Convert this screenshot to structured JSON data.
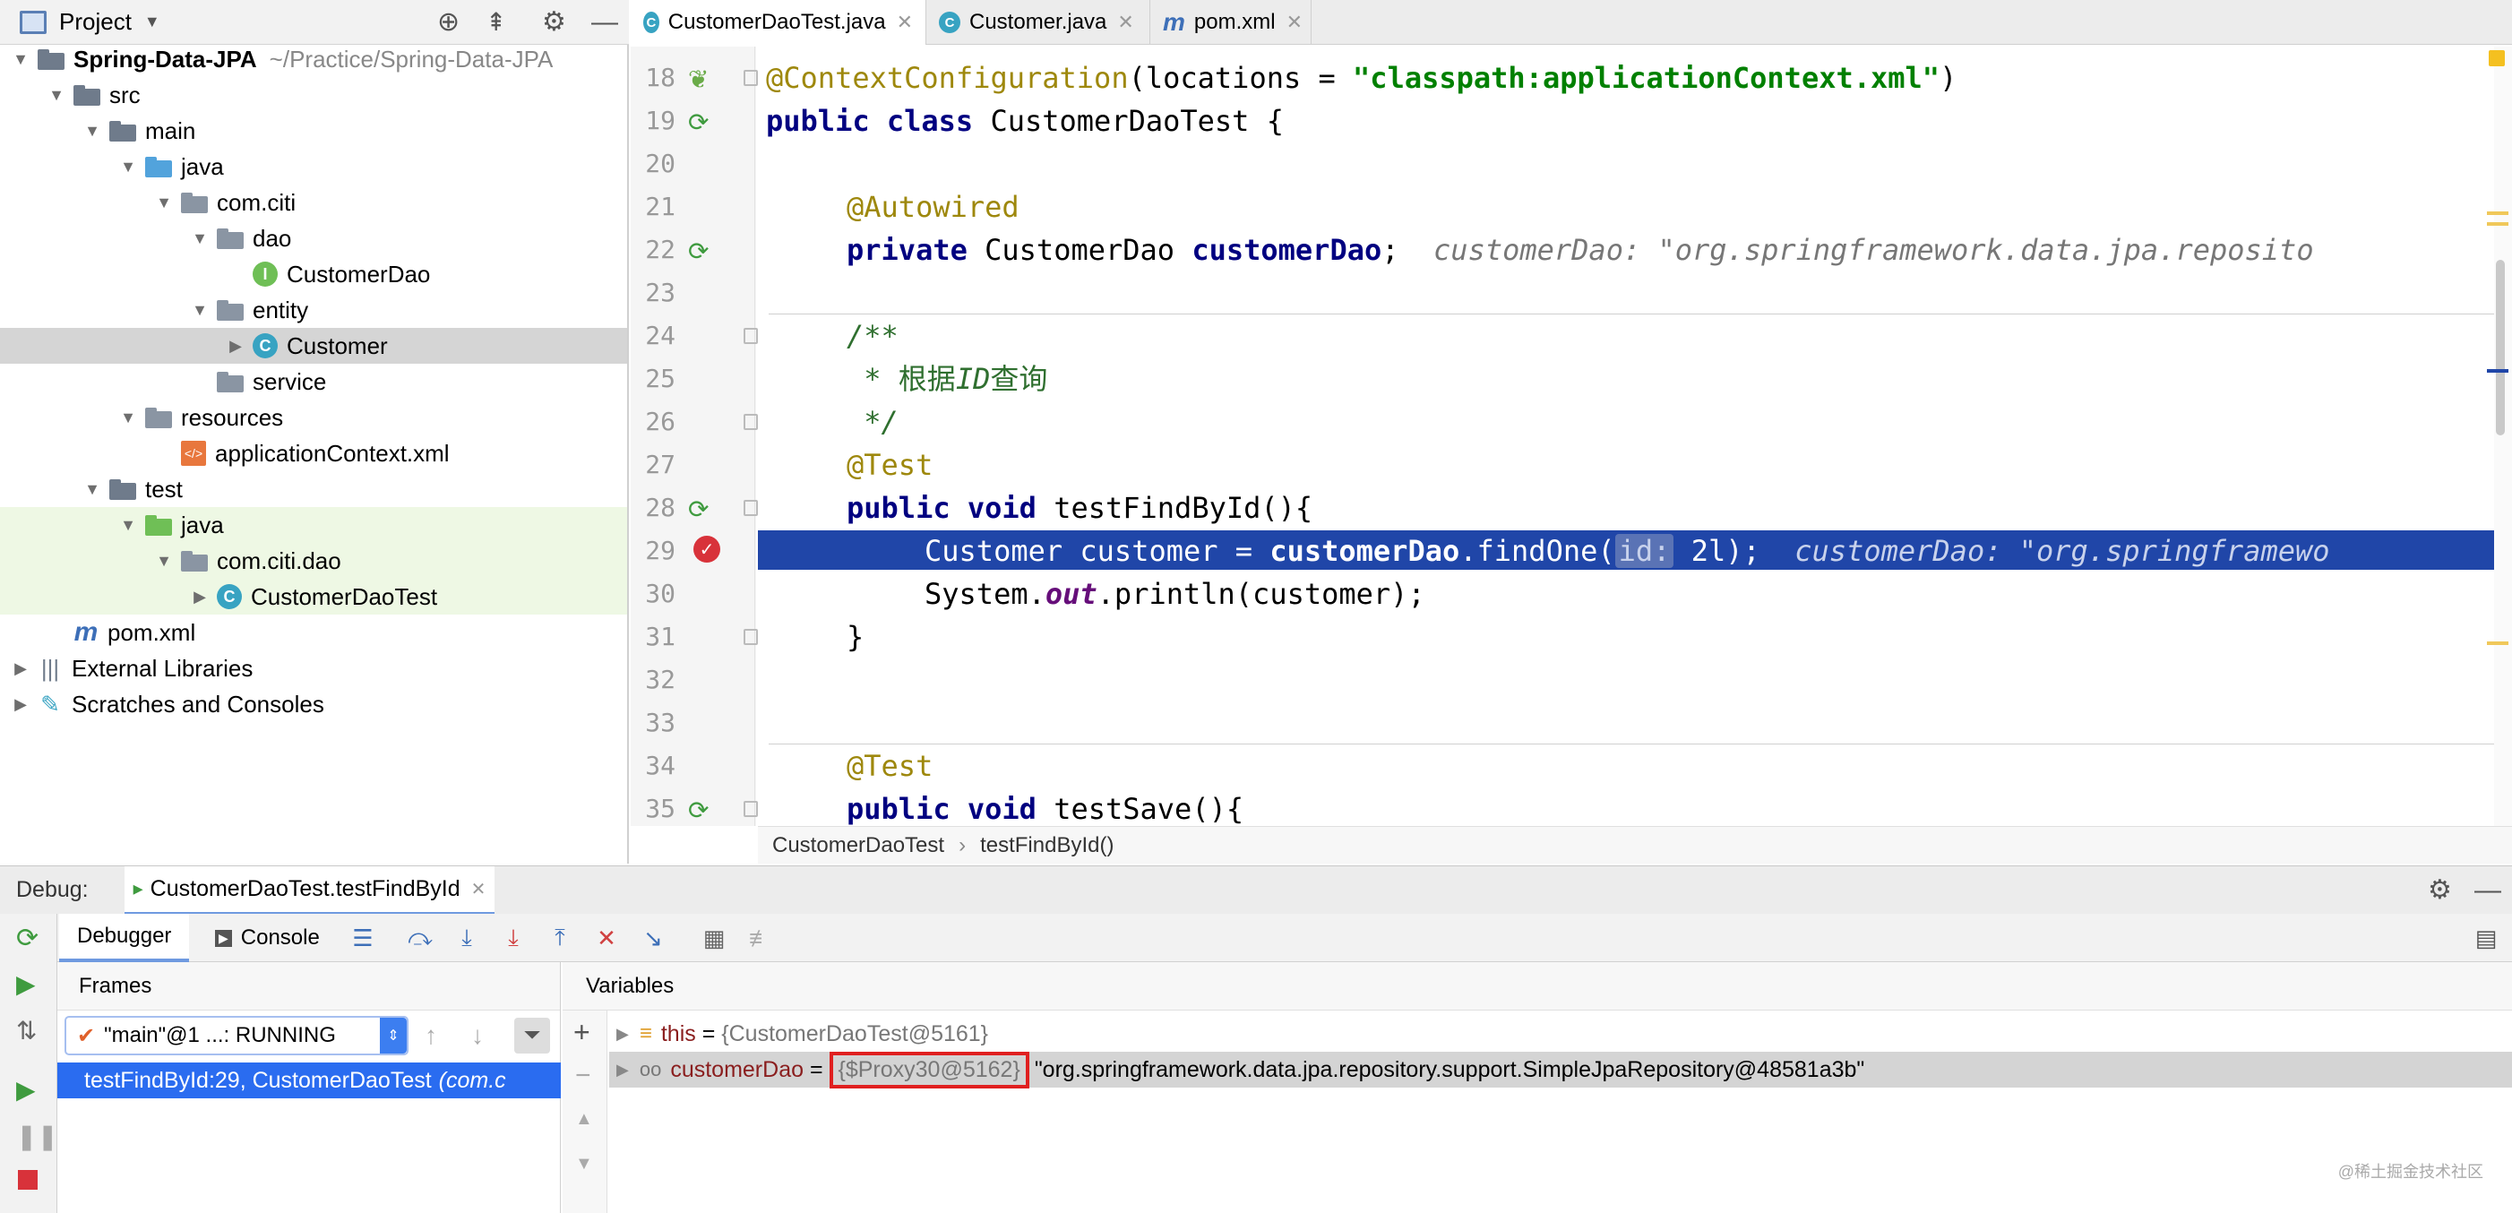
{
  "project_panel": {
    "title": "Project",
    "tree": [
      {
        "label": "Spring-Data-JPA",
        "suffix": "~/Practice/Spring-Data-JPA",
        "indent": 0,
        "arrow": "▼",
        "icon": "module-folder-icon"
      },
      {
        "label": "src",
        "indent": 1,
        "arrow": "▼",
        "icon": "folder-icon"
      },
      {
        "label": "main",
        "indent": 2,
        "arrow": "▼",
        "icon": "folder-icon"
      },
      {
        "label": "java",
        "indent": 3,
        "arrow": "▼",
        "icon": "source-folder-icon"
      },
      {
        "label": "com.citi",
        "indent": 4,
        "arrow": "▼",
        "icon": "package-icon"
      },
      {
        "label": "dao",
        "indent": 5,
        "arrow": "▼",
        "icon": "package-icon"
      },
      {
        "label": "CustomerDao",
        "indent": 6,
        "arrow": "",
        "icon": "interface-icon"
      },
      {
        "label": "entity",
        "indent": 5,
        "arrow": "▼",
        "icon": "package-icon"
      },
      {
        "label": "Customer",
        "indent": 6,
        "arrow": "▶",
        "icon": "class-icon"
      },
      {
        "label": "service",
        "indent": 5,
        "arrow": "",
        "icon": "package-icon"
      },
      {
        "label": "resources",
        "indent": 3,
        "arrow": "▼",
        "icon": "resources-folder-icon"
      },
      {
        "label": "applicationContext.xml",
        "indent": 4,
        "arrow": "",
        "icon": "xml-file-icon"
      },
      {
        "label": "test",
        "indent": 2,
        "arrow": "▼",
        "icon": "folder-icon"
      },
      {
        "label": "java",
        "indent": 3,
        "arrow": "▼",
        "icon": "test-folder-icon"
      },
      {
        "label": "com.citi.dao",
        "indent": 4,
        "arrow": "▼",
        "icon": "package-icon"
      },
      {
        "label": "CustomerDaoTest",
        "indent": 5,
        "arrow": "▶",
        "icon": "test-class-icon"
      },
      {
        "label": "pom.xml",
        "indent": 1,
        "arrow": "",
        "icon": "maven-icon"
      },
      {
        "label": "External Libraries",
        "indent": 0,
        "arrow": "▶",
        "icon": "libraries-icon"
      },
      {
        "label": "Scratches and Consoles",
        "indent": 0,
        "arrow": "▶",
        "icon": "scratches-icon"
      }
    ]
  },
  "tabs": [
    {
      "label": "CustomerDaoTest.java",
      "active": true,
      "icon": "test-class-icon"
    },
    {
      "label": "Customer.java",
      "active": false,
      "icon": "class-icon"
    },
    {
      "label": "pom.xml",
      "active": false,
      "icon": "maven-icon"
    }
  ],
  "editor": {
    "lines": [
      {
        "num": "18"
      },
      {
        "num": "19"
      },
      {
        "num": "20"
      },
      {
        "num": "21"
      },
      {
        "num": "22"
      },
      {
        "num": "23"
      },
      {
        "num": "24"
      },
      {
        "num": "25"
      },
      {
        "num": "26"
      },
      {
        "num": "27"
      },
      {
        "num": "28"
      },
      {
        "num": "29"
      },
      {
        "num": "30"
      },
      {
        "num": "31"
      },
      {
        "num": "32"
      },
      {
        "num": "33"
      },
      {
        "num": "34"
      },
      {
        "num": "35"
      }
    ],
    "l18_ann": "@ContextConfiguration",
    "l18_a": "(locations = ",
    "l18_str": "\"classpath:applicationContext.xml\"",
    "l18_b": ")",
    "l19_kw": "public class",
    "l19_rest": " CustomerDaoTest {",
    "l21_ann": "@Autowired",
    "l22_kw": "private",
    "l22_type": " CustomerDao ",
    "l22_field": "customerDao",
    "l22_semi": ";",
    "l22_hint": "customerDao: \"org.springframework.data.jpa.reposito",
    "l24": "/**",
    "l25": " * 根据",
    "l25_id": "ID",
    "l25_rest": "查询",
    "l26": " */",
    "l27_ann": "@Test",
    "l28_kw": "public void",
    "l28_rest": " testFindById(){",
    "l29_a": "Customer customer = ",
    "l29_field": "customerDao",
    "l29_b": ".findOne(",
    "l29_param": "id:",
    "l29_c": " 2l);",
    "l29_hint": "customerDao: \"org.springframewo",
    "l30_a": "System.",
    "l30_out": "out",
    "l30_b": ".println(customer);",
    "l31": "}",
    "l34_ann": "@Test",
    "l35_kw": "public void",
    "l35_rest": " testSave(){"
  },
  "breadcrumb": {
    "file": "CustomerDaoTest",
    "sep": "›",
    "method": "testFindById()"
  },
  "debug": {
    "label": "Debug:",
    "session": "CustomerDaoTest.testFindById",
    "tab_debugger": "Debugger",
    "tab_console": "Console",
    "frames_title": "Frames",
    "variables_title": "Variables",
    "thread": "\"main\"@1 ...: RUNNING",
    "frame": "testFindById:29, CustomerDaoTest",
    "frame_pkg": "(com.c",
    "vars": [
      {
        "name": "this",
        "eq": " = ",
        "value": "{CustomerDaoTest@5161}",
        "tostring": ""
      },
      {
        "name": "customerDao",
        "eq": " = ",
        "value": "{$Proxy30@5162}",
        "tostring": "\"org.springframework.data.jpa.repository.support.SimpleJpaRepository@48581a3b\""
      }
    ]
  },
  "watermark": "@稀土掘金技术社区",
  "colors": {
    "selection": "#2046a8",
    "highlight_box": "#e02020",
    "test_folder_bg": "#eef8e4"
  }
}
